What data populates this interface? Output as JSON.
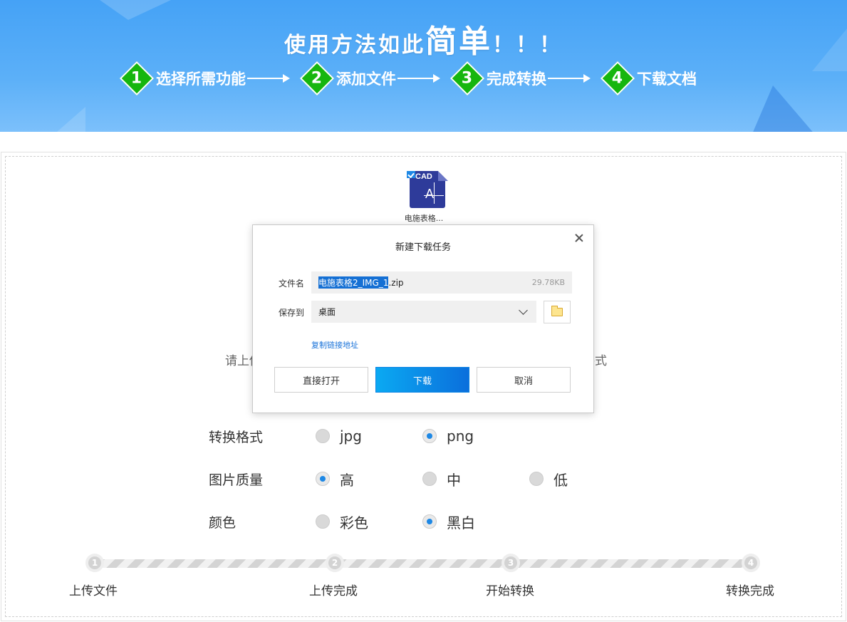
{
  "banner": {
    "headline_prefix": "使用方法如此",
    "headline_big": "简单",
    "headline_suffix": "！！！",
    "steps": [
      {
        "num": "1",
        "label": "选择所需功能"
      },
      {
        "num": "2",
        "label": "添加文件"
      },
      {
        "num": "3",
        "label": "完成转换"
      },
      {
        "num": "4",
        "label": "下载文档"
      }
    ]
  },
  "upload": {
    "file_badge": "CAD",
    "file_name": "电施表格...",
    "hint_left": "请上传",
    "hint_right": "格式"
  },
  "options": {
    "format": {
      "title": "转换格式",
      "choices": [
        "jpg",
        "png"
      ],
      "selected": "png"
    },
    "quality": {
      "title": "图片质量",
      "choices": [
        "高",
        "中",
        "低"
      ],
      "selected": "高"
    },
    "color": {
      "title": "颜色",
      "choices": [
        "彩色",
        "黑白"
      ],
      "selected": "黑白"
    }
  },
  "progress": {
    "steps": [
      {
        "num": "1",
        "label": "上传文件"
      },
      {
        "num": "2",
        "label": "上传完成"
      },
      {
        "num": "3",
        "label": "开始转换"
      },
      {
        "num": "4",
        "label": "转换完成"
      }
    ]
  },
  "dialog": {
    "title": "新建下载任务",
    "filename_label": "文件名",
    "filename_selected": "电施表格2_IMG_1",
    "filename_ext": ".zip",
    "file_size": "29.78KB",
    "saveto_label": "保存到",
    "saveto_value": "桌面",
    "copy_link": "复制链接地址",
    "btn_open": "直接打开",
    "btn_download": "下载",
    "btn_cancel": "取消"
  }
}
